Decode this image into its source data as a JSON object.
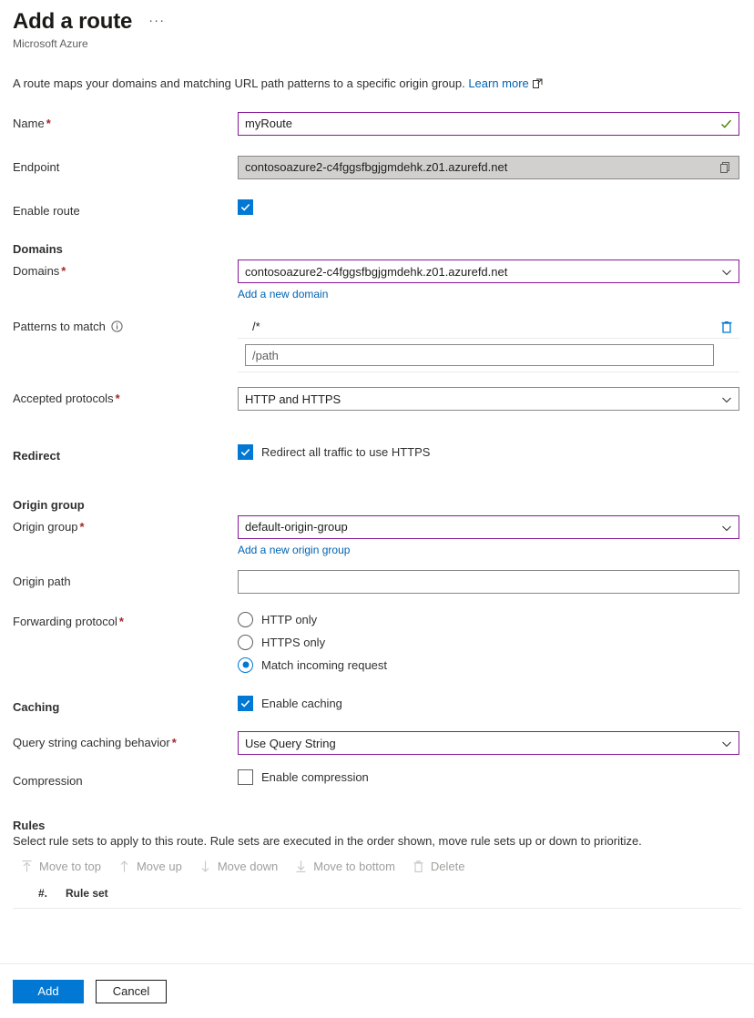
{
  "header": {
    "title": "Add a route",
    "more_label": "···",
    "subtitle": "Microsoft Azure"
  },
  "intro": {
    "text": "A route maps your domains and matching URL path patterns to a specific origin group.",
    "learn_more": "Learn more"
  },
  "fields": {
    "name": {
      "label": "Name",
      "required": "*",
      "value": "myRoute",
      "validation": "valid"
    },
    "endpoint": {
      "label": "Endpoint",
      "value": "contosoazure2-c4fggsfbgjgmdehk.z01.azurefd.net",
      "copy_tooltip": "Copy to clipboard"
    },
    "enable_route": {
      "label": "Enable route",
      "checked": true
    }
  },
  "domains_section": {
    "heading": "Domains",
    "domains": {
      "label": "Domains",
      "required": "*",
      "value": "contosoazure2-c4fggsfbgjgmdehk.z01.azurefd.net",
      "add_link": "Add a new domain"
    },
    "patterns": {
      "label": "Patterns to match",
      "rows": [
        "/*"
      ],
      "input_placeholder": "/path",
      "input_value": ""
    },
    "accepted_protocols": {
      "label": "Accepted protocols",
      "required": "*",
      "value": "HTTP and HTTPS"
    },
    "redirect": {
      "label": "Redirect",
      "checkbox_label": "Redirect all traffic to use HTTPS",
      "checked": true
    }
  },
  "origin_section": {
    "heading": "Origin group",
    "origin_group": {
      "label": "Origin group",
      "required": "*",
      "value": "default-origin-group",
      "add_link": "Add a new origin group"
    },
    "origin_path": {
      "label": "Origin path",
      "value": "",
      "placeholder": ""
    },
    "forwarding_protocol": {
      "label": "Forwarding protocol",
      "required": "*",
      "options": [
        {
          "label": "HTTP only",
          "selected": false
        },
        {
          "label": "HTTPS only",
          "selected": false
        },
        {
          "label": "Match incoming request",
          "selected": true
        }
      ]
    }
  },
  "caching_section": {
    "heading": "Caching",
    "enable_caching": {
      "checkbox_label": "Enable caching",
      "checked": true
    },
    "query_string": {
      "label": "Query string caching behavior",
      "required": "*",
      "value": "Use Query String"
    },
    "compression": {
      "label": "Compression",
      "checkbox_label": "Enable compression",
      "checked": false
    }
  },
  "rules_section": {
    "heading": "Rules",
    "description": "Select rule sets to apply to this route. Rule sets are executed in the order shown, move rule sets up or down to prioritize.",
    "commands": [
      {
        "label": "Move to top",
        "icon": "move-to-top-icon",
        "enabled": false
      },
      {
        "label": "Move up",
        "icon": "move-up-icon",
        "enabled": false
      },
      {
        "label": "Move down",
        "icon": "move-down-icon",
        "enabled": false
      },
      {
        "label": "Move to bottom",
        "icon": "move-to-bottom-icon",
        "enabled": false
      },
      {
        "label": "Delete",
        "icon": "delete-icon",
        "enabled": false
      }
    ],
    "columns": [
      "#.",
      "Rule set"
    ],
    "rows": []
  },
  "footer": {
    "add_label": "Add",
    "cancel_label": "Cancel"
  },
  "colors": {
    "accent": "#0078d4",
    "validated_border": "#881798",
    "required_asterisk": "#a4262c",
    "link": "#0063b1",
    "success_check": "#498205",
    "disabled_text": "#a19f9d"
  }
}
